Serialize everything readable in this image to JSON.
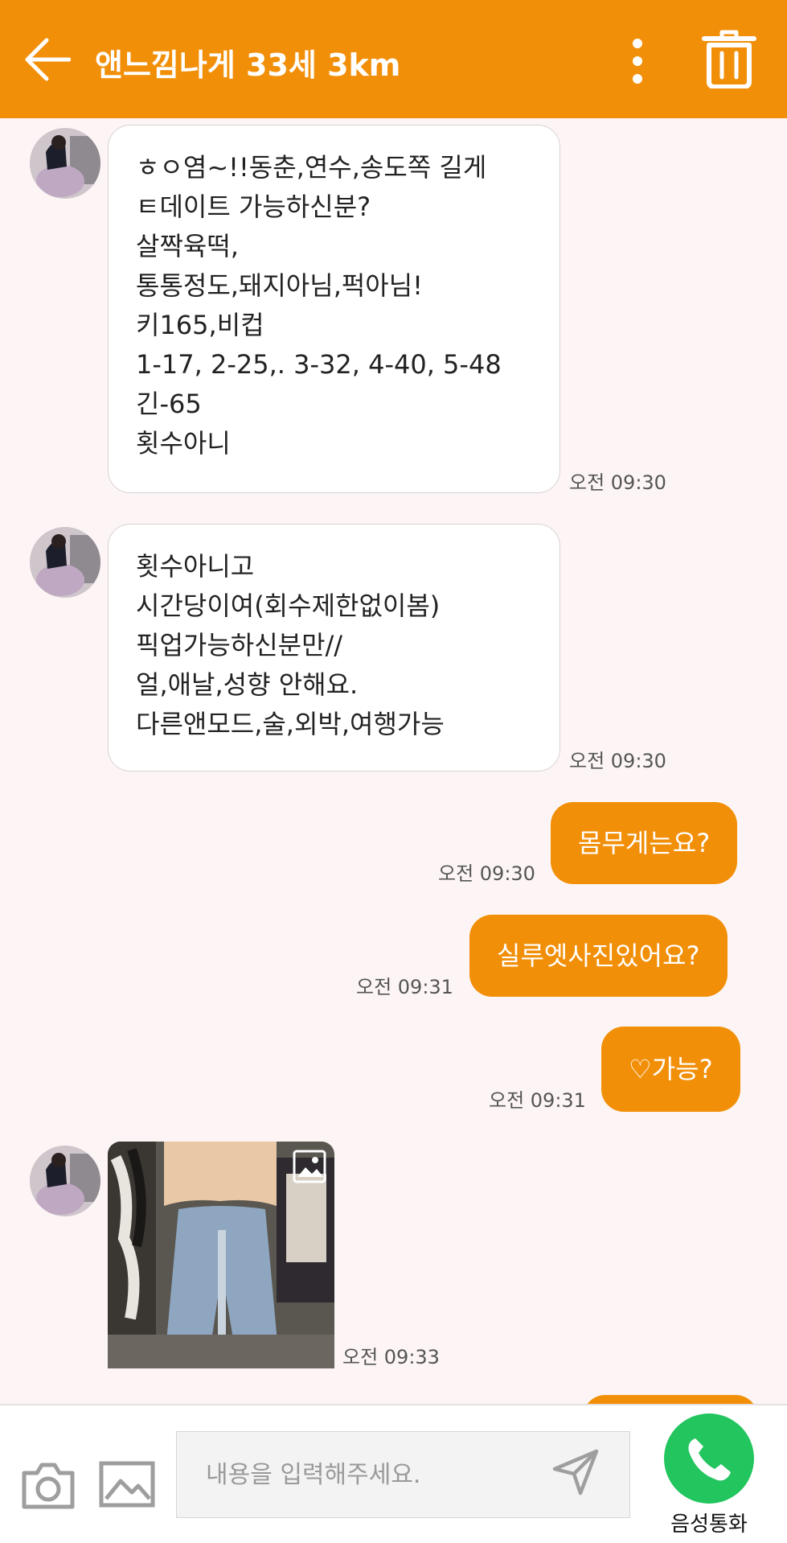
{
  "header": {
    "title": "앤느낌나게 33세 3km",
    "back_icon": "arrow-left-icon",
    "more_icon": "more-vertical-icon",
    "delete_icon": "trash-icon",
    "color": "#f28f08"
  },
  "messages": [
    {
      "direction": "in",
      "lines": [
        "ㅎㅇ염~!!동춘,연수,송도쪽 길게",
        "ㅌ데이트 가능하신분?",
        "살짝육떡,",
        "통통정도,돼지아님,퍽아님!",
        "키165,비컵",
        "1-17, 2-25,. 3-32, 4-40, 5-48",
        "긴-65",
        "횟수아니"
      ],
      "time": "오전 09:30"
    },
    {
      "direction": "in",
      "lines": [
        "횟수아니고",
        "시간당이여(회수제한없이봄)",
        "픽업가능하신분만//",
        "얼,애날,성향 안해요.",
        "다른앤모드,술,외박,여행가능"
      ],
      "time": "오전 09:30"
    },
    {
      "direction": "out",
      "text": "몸무게는요?",
      "time": "오전 09:30"
    },
    {
      "direction": "out",
      "text": "실루엣사진있어요?",
      "time": "오전 09:31"
    },
    {
      "direction": "out",
      "text": "♡가능?",
      "time": "오전 09:31"
    },
    {
      "direction": "in",
      "type": "image",
      "time": "오전 09:33"
    }
  ],
  "composer": {
    "placeholder": "내용을 입력해주세요.",
    "camera_icon": "camera-icon",
    "gallery_icon": "image-icon",
    "send_icon": "send-icon",
    "call_icon": "phone-icon",
    "call_label": "음성통화",
    "call_color": "#22c55e"
  }
}
